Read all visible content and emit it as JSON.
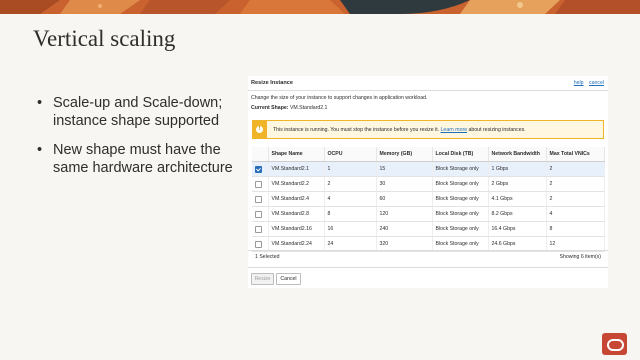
{
  "slide": {
    "title": "Vertical scaling",
    "bullets": [
      "Scale-up and Scale-down; instance shape supported",
      "New shape must have the same hardware architecture"
    ]
  },
  "resize_panel": {
    "title": "Resize Instance",
    "links": {
      "help": "help",
      "cancel": "cancel"
    },
    "description": "Change the size of your instance to support changes in application workload.",
    "current_shape_label": "Current Shape:",
    "current_shape_value": "VM.Standard2.1",
    "warning": {
      "text": "This instance is running. You must stop the instance before you resize it.",
      "link": "Learn more",
      "suffix": "about resizing instances."
    },
    "table": {
      "headers": [
        "Shape Name",
        "OCPU",
        "Memory (GB)",
        "Local Disk (TB)",
        "Network Bandwidth",
        "Max Total VNICs"
      ],
      "rows": [
        {
          "selected": true,
          "cells": [
            "VM.Standard2.1",
            "1",
            "15",
            "Block Storage only",
            "1 Gbps",
            "2"
          ]
        },
        {
          "selected": false,
          "cells": [
            "VM.Standard2.2",
            "2",
            "30",
            "Block Storage only",
            "2 Gbps",
            "2"
          ]
        },
        {
          "selected": false,
          "cells": [
            "VM.Standard2.4",
            "4",
            "60",
            "Block Storage only",
            "4.1 Gbps",
            "2"
          ]
        },
        {
          "selected": false,
          "cells": [
            "VM.Standard2.8",
            "8",
            "120",
            "Block Storage only",
            "8.2 Gbps",
            "4"
          ]
        },
        {
          "selected": false,
          "cells": [
            "VM.Standard2.16",
            "16",
            "240",
            "Block Storage only",
            "16.4 Gbps",
            "8"
          ]
        },
        {
          "selected": false,
          "cells": [
            "VM.Standard2.24",
            "24",
            "320",
            "Block Storage only",
            "24.6 Gbps",
            "12"
          ]
        }
      ]
    },
    "footer": {
      "selected_text": "1 Selected",
      "showing_text": "Showing 6 item(s)"
    },
    "buttons": {
      "resize": "Resize",
      "cancel": "Cancel"
    }
  },
  "colors": {
    "brand": "#c74634",
    "link": "#1e6fb8",
    "warning": "#f0b429",
    "selected_row": "#e8f1fb"
  },
  "icons": {
    "warning": "warning-icon",
    "logo": "oracle-logo-icon",
    "checkbox": "checkbox-icon"
  }
}
